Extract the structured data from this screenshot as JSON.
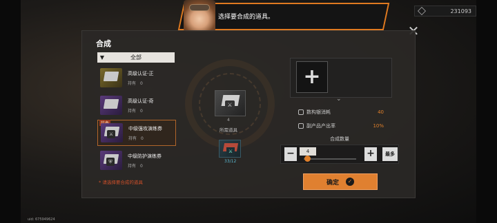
{
  "header": {
    "currency_value": "231093",
    "dialogue_text": "选择要合成的道具。"
  },
  "panel": {
    "title": "合成",
    "filter_label": "全部",
    "items": [
      {
        "name": "高级认证-正",
        "own_label": "持有",
        "own_value": "0",
        "selected": false,
        "equip_tag": ""
      },
      {
        "name": "高级认证-奇",
        "own_label": "持有",
        "own_value": "0",
        "selected": false,
        "equip_tag": ""
      },
      {
        "name": "中级强攻演练券",
        "own_label": "持有",
        "own_value": "0",
        "selected": true,
        "equip_tag": "装备"
      },
      {
        "name": "中级防护演练券",
        "own_label": "持有",
        "own_value": "0",
        "selected": false,
        "equip_tag": ""
      }
    ],
    "hint": "* 请选择要合成的道具"
  },
  "center": {
    "required_count": "4",
    "required_label": "所需道具",
    "material_count": "33/12"
  },
  "right": {
    "stat1_label": "数构银消耗",
    "stat1_value": "40",
    "stat2_label": "副产品产出率",
    "stat2_value": "10%",
    "qty_label": "合成数量",
    "qty_value": "4",
    "qty_fraction": 0.05,
    "max_label": "最多",
    "confirm_label": "确定"
  },
  "footer": {
    "uid": "uid: 675949624"
  },
  "colors": {
    "accent": "#e08030",
    "warning": "#d0502a",
    "material_count": "#5ab8d0"
  }
}
